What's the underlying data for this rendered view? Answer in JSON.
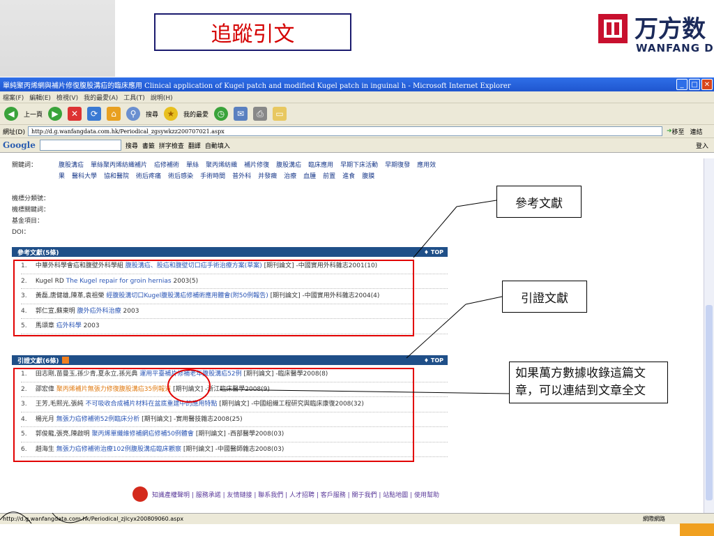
{
  "slide": {
    "title": "追蹤引文",
    "logo_cn": "万方数",
    "logo_en": "WANFANG DA"
  },
  "window": {
    "title": "單純聚丙烯網與補片修復腹股溝疝的臨床應用 Clinical application of Kugel patch and modified Kugel patch in inguinal h - Microsoft Internet Explorer",
    "menu": [
      "檔案(F)",
      "編輯(E)",
      "檢視(V)",
      "我的最愛(A)",
      "工具(T)",
      "說明(H)"
    ],
    "toolbar": {
      "back": "上一頁",
      "search": "搜尋",
      "favorites": "我的最愛"
    },
    "address_label": "網址(D)",
    "address": "http://d.g.wanfangdata.com.hk/Periodical_zgsywkzz200707021.aspx",
    "go_label": "移至",
    "links_label": "連結",
    "google": {
      "logo": "Google",
      "search": "搜尋",
      "bookmarks": "書籤",
      "spell": "拼字檢查",
      "translate": "翻譯",
      "autofill": "自動填入",
      "login": "登入"
    },
    "status_url": "http://d.g.wanfangdata.com.hk/Periodical_zjlcyx200809060.aspx",
    "status_zone": "網際網路"
  },
  "meta": {
    "keywords_label": "關鍵詞：",
    "keywords": [
      "腹股溝疝",
      "單絲聚丙烯紡織補片",
      "疝修補術",
      "單絲",
      "聚丙烯紡織",
      "補片修復",
      "腹股溝疝",
      "臨床應用",
      "早期下床活動",
      "早期復發",
      "應用效果",
      "醫科大學",
      "協和醫院",
      "術后疼痛",
      "術后感染",
      "手術時間",
      "普外科",
      "并發癥",
      "治療",
      "血腫",
      "前置",
      "進食",
      "腹膜"
    ],
    "class_label": "機標分類號：",
    "mkw_label": "機標關鍵詞：",
    "fund_label": "基金項目：",
    "doi_label": "DOI："
  },
  "references": {
    "header": "參考文獻(5條)",
    "top": "TOP",
    "items": [
      {
        "n": "1.",
        "authors": "中華外科學會疝和腹壁外科學組",
        "title": "腹股溝疝、股疝和腹壁切口疝手術治療方案(草案)",
        "tail": "[期刊論文] -中國實用外科雜志2001(10)"
      },
      {
        "n": "2.",
        "authors": "Kugel RD",
        "title": "The Kugel repair for groin hernias",
        "tail": "2003(5)"
      },
      {
        "n": "3.",
        "authors": "黃磊,唐健雄,陳革,袁祖榮",
        "title": "經腹股溝切口Kugel腹股溝疝修補術應用體會(附50例報告)",
        "tail": "[期刊論文] -中國實用外科雜志2004(4)"
      },
      {
        "n": "4.",
        "authors": "郭仁宣,蘇東明",
        "title": "腹外疝外科治療",
        "tail": "2003"
      },
      {
        "n": "5.",
        "authors": "馬頌章",
        "title": "疝外科學",
        "tail": "2003"
      }
    ]
  },
  "citations": {
    "header": "引證文獻(6條)",
    "top": "TOP",
    "items": [
      {
        "n": "1.",
        "authors": "田志剛,苗曼玉,孫少青,夏永立,孫光典",
        "title": "運用平臺補片修補老年腹股溝疝52例",
        "tail": "[期刊論文] -臨床醫學2008(8)"
      },
      {
        "n": "2.",
        "authors": "邵宏偉",
        "title": "聚丙烯補片無張力修復腹股溝疝35例報道",
        "tail": "[期刊論文] -浙江臨床醫學2008(9)"
      },
      {
        "n": "3.",
        "authors": "王芳,毛熙光,張純",
        "title": "不可吸收合成補片材料在盆底重建中的應用特點",
        "tail": "[期刊論文] -中國組織工程研究與臨床康復2008(32)"
      },
      {
        "n": "4.",
        "authors": "楊光月",
        "title": "無張力疝修補術52例臨床分析",
        "tail": "[期刊論文] -實用醫技雜志2008(25)"
      },
      {
        "n": "5.",
        "authors": "郭俊龍,張亮,陳啟明",
        "title": "聚丙烯單纖維修補網疝修補50例體會",
        "tail": "[期刊論文] -西部醫學2008(03)"
      },
      {
        "n": "6.",
        "authors": "趙海生",
        "title": "無張力疝修補術治療102例腹股溝疝臨床觀察",
        "tail": "[期刊論文] -中國醫師雜志2008(03)"
      }
    ]
  },
  "footer": "知識產權聲明 | 服務承諾 | 友情鏈接 | 聯系我們 | 人才招聘 | 客戶服務 | 關于我們 | 站點地圖 | 使用幫助",
  "callouts": {
    "ref": "參考文獻",
    "cite": "引證文獻",
    "note": "如果萬方數據收錄這篇文章，可以連結到文章全文"
  },
  "colors": {
    "red_box": "#e20000",
    "section_header": "#1f4f88",
    "link": "#2a55b5"
  }
}
